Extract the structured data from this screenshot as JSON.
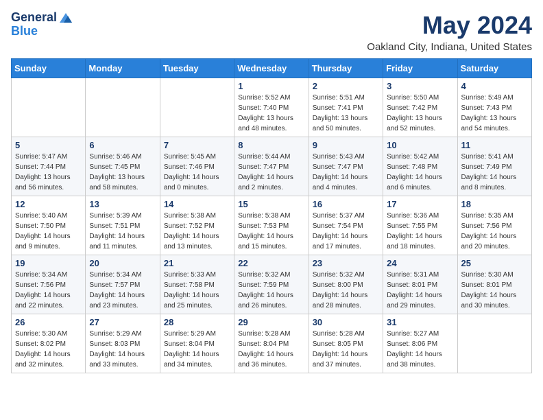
{
  "logo": {
    "general": "General",
    "blue": "Blue"
  },
  "title": "May 2024",
  "subtitle": "Oakland City, Indiana, United States",
  "days_of_week": [
    "Sunday",
    "Monday",
    "Tuesday",
    "Wednesday",
    "Thursday",
    "Friday",
    "Saturday"
  ],
  "weeks": [
    [
      {
        "day": "",
        "info": ""
      },
      {
        "day": "",
        "info": ""
      },
      {
        "day": "",
        "info": ""
      },
      {
        "day": "1",
        "info": "Sunrise: 5:52 AM\nSunset: 7:40 PM\nDaylight: 13 hours\nand 48 minutes."
      },
      {
        "day": "2",
        "info": "Sunrise: 5:51 AM\nSunset: 7:41 PM\nDaylight: 13 hours\nand 50 minutes."
      },
      {
        "day": "3",
        "info": "Sunrise: 5:50 AM\nSunset: 7:42 PM\nDaylight: 13 hours\nand 52 minutes."
      },
      {
        "day": "4",
        "info": "Sunrise: 5:49 AM\nSunset: 7:43 PM\nDaylight: 13 hours\nand 54 minutes."
      }
    ],
    [
      {
        "day": "5",
        "info": "Sunrise: 5:47 AM\nSunset: 7:44 PM\nDaylight: 13 hours\nand 56 minutes."
      },
      {
        "day": "6",
        "info": "Sunrise: 5:46 AM\nSunset: 7:45 PM\nDaylight: 13 hours\nand 58 minutes."
      },
      {
        "day": "7",
        "info": "Sunrise: 5:45 AM\nSunset: 7:46 PM\nDaylight: 14 hours\nand 0 minutes."
      },
      {
        "day": "8",
        "info": "Sunrise: 5:44 AM\nSunset: 7:47 PM\nDaylight: 14 hours\nand 2 minutes."
      },
      {
        "day": "9",
        "info": "Sunrise: 5:43 AM\nSunset: 7:47 PM\nDaylight: 14 hours\nand 4 minutes."
      },
      {
        "day": "10",
        "info": "Sunrise: 5:42 AM\nSunset: 7:48 PM\nDaylight: 14 hours\nand 6 minutes."
      },
      {
        "day": "11",
        "info": "Sunrise: 5:41 AM\nSunset: 7:49 PM\nDaylight: 14 hours\nand 8 minutes."
      }
    ],
    [
      {
        "day": "12",
        "info": "Sunrise: 5:40 AM\nSunset: 7:50 PM\nDaylight: 14 hours\nand 9 minutes."
      },
      {
        "day": "13",
        "info": "Sunrise: 5:39 AM\nSunset: 7:51 PM\nDaylight: 14 hours\nand 11 minutes."
      },
      {
        "day": "14",
        "info": "Sunrise: 5:38 AM\nSunset: 7:52 PM\nDaylight: 14 hours\nand 13 minutes."
      },
      {
        "day": "15",
        "info": "Sunrise: 5:38 AM\nSunset: 7:53 PM\nDaylight: 14 hours\nand 15 minutes."
      },
      {
        "day": "16",
        "info": "Sunrise: 5:37 AM\nSunset: 7:54 PM\nDaylight: 14 hours\nand 17 minutes."
      },
      {
        "day": "17",
        "info": "Sunrise: 5:36 AM\nSunset: 7:55 PM\nDaylight: 14 hours\nand 18 minutes."
      },
      {
        "day": "18",
        "info": "Sunrise: 5:35 AM\nSunset: 7:56 PM\nDaylight: 14 hours\nand 20 minutes."
      }
    ],
    [
      {
        "day": "19",
        "info": "Sunrise: 5:34 AM\nSunset: 7:56 PM\nDaylight: 14 hours\nand 22 minutes."
      },
      {
        "day": "20",
        "info": "Sunrise: 5:34 AM\nSunset: 7:57 PM\nDaylight: 14 hours\nand 23 minutes."
      },
      {
        "day": "21",
        "info": "Sunrise: 5:33 AM\nSunset: 7:58 PM\nDaylight: 14 hours\nand 25 minutes."
      },
      {
        "day": "22",
        "info": "Sunrise: 5:32 AM\nSunset: 7:59 PM\nDaylight: 14 hours\nand 26 minutes."
      },
      {
        "day": "23",
        "info": "Sunrise: 5:32 AM\nSunset: 8:00 PM\nDaylight: 14 hours\nand 28 minutes."
      },
      {
        "day": "24",
        "info": "Sunrise: 5:31 AM\nSunset: 8:01 PM\nDaylight: 14 hours\nand 29 minutes."
      },
      {
        "day": "25",
        "info": "Sunrise: 5:30 AM\nSunset: 8:01 PM\nDaylight: 14 hours\nand 30 minutes."
      }
    ],
    [
      {
        "day": "26",
        "info": "Sunrise: 5:30 AM\nSunset: 8:02 PM\nDaylight: 14 hours\nand 32 minutes."
      },
      {
        "day": "27",
        "info": "Sunrise: 5:29 AM\nSunset: 8:03 PM\nDaylight: 14 hours\nand 33 minutes."
      },
      {
        "day": "28",
        "info": "Sunrise: 5:29 AM\nSunset: 8:04 PM\nDaylight: 14 hours\nand 34 minutes."
      },
      {
        "day": "29",
        "info": "Sunrise: 5:28 AM\nSunset: 8:04 PM\nDaylight: 14 hours\nand 36 minutes."
      },
      {
        "day": "30",
        "info": "Sunrise: 5:28 AM\nSunset: 8:05 PM\nDaylight: 14 hours\nand 37 minutes."
      },
      {
        "day": "31",
        "info": "Sunrise: 5:27 AM\nSunset: 8:06 PM\nDaylight: 14 hours\nand 38 minutes."
      },
      {
        "day": "",
        "info": ""
      }
    ]
  ]
}
